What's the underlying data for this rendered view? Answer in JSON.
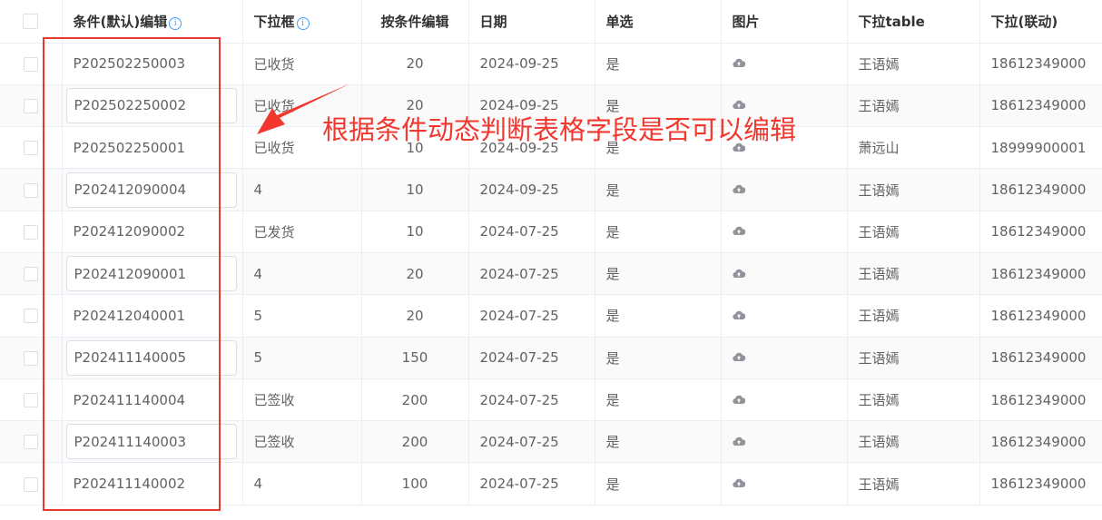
{
  "table": {
    "headers": {
      "code": "条件(默认)编辑",
      "select": "下拉框",
      "cond_edit": "按条件编辑",
      "date": "日期",
      "radio": "单选",
      "image": "图片",
      "select_table": "下拉table",
      "linked": "下拉(联动)"
    },
    "info_glyph": "i",
    "rows": [
      {
        "code": "P202502250003",
        "editable": false,
        "select": "已收货",
        "num": "20",
        "date": "2024-09-25",
        "radio": "是",
        "name": "王语嫣",
        "phone": "18612349000"
      },
      {
        "code": "P202502250002",
        "editable": true,
        "select": "已收货",
        "num": "20",
        "date": "2024-09-25",
        "radio": "是",
        "name": "王语嫣",
        "phone": "18612349000"
      },
      {
        "code": "P202502250001",
        "editable": false,
        "select": "已收货",
        "num": "10",
        "date": "2024-09-25",
        "radio": "是",
        "name": "萧远山",
        "phone": "18999900001"
      },
      {
        "code": "P202412090004",
        "editable": true,
        "select": "4",
        "num": "10",
        "date": "2024-09-25",
        "radio": "是",
        "name": "王语嫣",
        "phone": "18612349000"
      },
      {
        "code": "P202412090002",
        "editable": false,
        "select": "已发货",
        "num": "10",
        "date": "2024-07-25",
        "radio": "是",
        "name": "王语嫣",
        "phone": "18612349000"
      },
      {
        "code": "P202412090001",
        "editable": true,
        "select": "4",
        "num": "20",
        "date": "2024-07-25",
        "radio": "是",
        "name": "王语嫣",
        "phone": "18612349000"
      },
      {
        "code": "P202412040001",
        "editable": false,
        "select": "5",
        "num": "20",
        "date": "2024-07-25",
        "radio": "是",
        "name": "王语嫣",
        "phone": "18612349000"
      },
      {
        "code": "P202411140005",
        "editable": true,
        "select": "5",
        "num": "150",
        "date": "2024-07-25",
        "radio": "是",
        "name": "王语嫣",
        "phone": "18612349000"
      },
      {
        "code": "P202411140004",
        "editable": false,
        "select": "已签收",
        "num": "200",
        "date": "2024-07-25",
        "radio": "是",
        "name": "王语嫣",
        "phone": "18612349000"
      },
      {
        "code": "P202411140003",
        "editable": true,
        "select": "已签收",
        "num": "200",
        "date": "2024-07-25",
        "radio": "是",
        "name": "王语嫣",
        "phone": "18612349000"
      },
      {
        "code": "P202411140002",
        "editable": false,
        "select": "4",
        "num": "100",
        "date": "2024-07-25",
        "radio": "是",
        "name": "王语嫣",
        "phone": "18612349000"
      }
    ]
  },
  "annotation": {
    "text": "根据条件动态判断表格字段是否可以编辑",
    "color": "#f2372e"
  },
  "icons": {
    "row_image": "cloud-upload-icon",
    "header_hint": "info-icon"
  }
}
